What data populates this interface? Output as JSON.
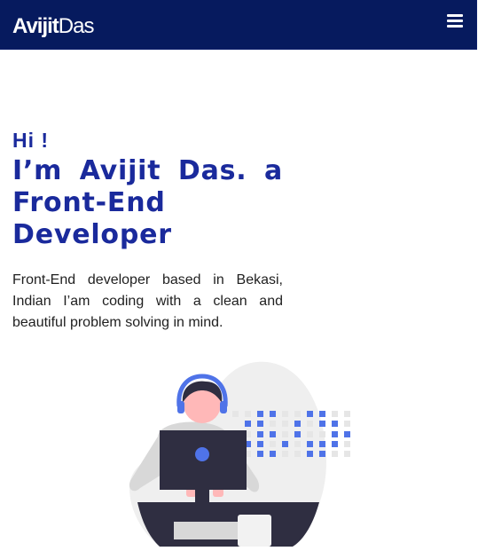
{
  "nav": {
    "brand_bold": "Avijit",
    "brand_light": "Das",
    "menu_icon": "hamburger-menu-icon"
  },
  "hero": {
    "greeting": "Hi !",
    "headline": "I’m Avijit Das. a Front-End Developer",
    "description": "Front-End developer based in Bekasi, Indian I’am coding with a clean and beautiful problem solving in mind."
  },
  "colors": {
    "navbar_bg": "#061a5e",
    "accent": "#1a2a9c",
    "dot_blue": "#4f73e8",
    "illustration_dark": "#2f2e41"
  }
}
